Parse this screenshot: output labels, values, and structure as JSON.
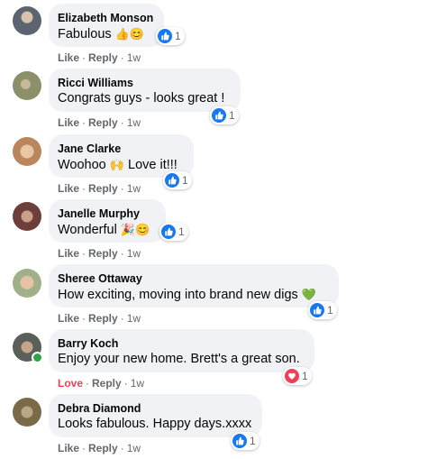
{
  "comments": [
    {
      "name": "Elizabeth Monson",
      "text": "Fabulous",
      "emojis": "👍😊",
      "reaction_count": "1",
      "reaction_type": "like",
      "action_label": "Like",
      "reply_label": "Reply",
      "time": "1w",
      "avatar_color": "#7d8a99"
    },
    {
      "name": "Ricci Williams",
      "text": "Congrats guys - looks great !",
      "emojis": "",
      "reaction_count": "1",
      "reaction_type": "like",
      "action_label": "Like",
      "reply_label": "Reply",
      "time": "1w",
      "avatar_color": "#8b8f6a"
    },
    {
      "name": "Jane Clarke",
      "text": "Woohoo",
      "emojis": "🙌",
      "text_after": "Love it!!!",
      "reaction_count": "1",
      "reaction_type": "like",
      "action_label": "Like",
      "reply_label": "Reply",
      "time": "1w",
      "avatar_color": "#b9865e"
    },
    {
      "name": "Janelle Murphy",
      "text": "Wonderful",
      "emojis": "🎉😊",
      "reaction_count": "1",
      "reaction_type": "like",
      "action_label": "Like",
      "reply_label": "Reply",
      "time": "1w",
      "avatar_color": "#6e3f3a"
    },
    {
      "name": "Sheree Ottaway",
      "text": "How exciting, moving into brand new digs",
      "emojis": "💚",
      "reaction_count": "1",
      "reaction_type": "like",
      "action_label": "Like",
      "reply_label": "Reply",
      "time": "1w",
      "avatar_color": "#9fb08a"
    },
    {
      "name": "Barry Koch",
      "text": "Enjoy your new home. Brett's a great son.",
      "emojis": "",
      "reaction_count": "1",
      "reaction_type": "love",
      "action_label": "Love",
      "reply_label": "Reply",
      "time": "1w",
      "avatar_color": "#5b5f5a",
      "online": true
    },
    {
      "name": "Debra Diamond",
      "text": "Looks fabulous. Happy days.xxxx",
      "emojis": "",
      "reaction_count": "1",
      "reaction_type": "like",
      "action_label": "Like",
      "reply_label": "Reply",
      "time": "1w",
      "avatar_color": "#7a6a48"
    }
  ],
  "colors": {
    "like_blue": "#1877f2",
    "love_red": "#f33e58",
    "bubble_bg": "#f0f2f5",
    "muted_text": "#65676b"
  }
}
